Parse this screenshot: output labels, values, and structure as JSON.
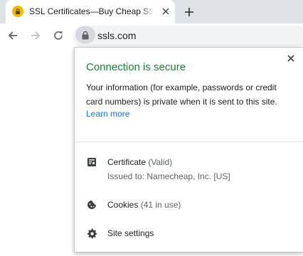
{
  "tab": {
    "title": "SSL Certificates—Buy Cheap SSL",
    "favicon_icon": "lock-favicon-icon",
    "favicon_color": "#f5b800"
  },
  "toolbar": {
    "url": "ssls.com",
    "back_icon": "back-arrow-icon",
    "forward_icon": "forward-arrow-icon",
    "reload_icon": "reload-icon",
    "security_icon": "lock-icon"
  },
  "popup": {
    "title": "Connection is secure",
    "title_color": "#188038",
    "description": "Your information (for example, passwords or credit card numbers) is private when it is sent to this site.",
    "learn_more": "Learn more",
    "learn_more_color": "#1a73e8",
    "certificate": {
      "label": "Certificate",
      "status": "(Valid)",
      "issued_to": "Issued to: Namecheap, Inc. [US]",
      "icon": "certificate-icon"
    },
    "cookies": {
      "label": "Cookies",
      "count": "(41 in use)",
      "icon": "cookie-icon"
    },
    "site_settings": {
      "label": "Site settings",
      "icon": "gear-icon"
    }
  }
}
